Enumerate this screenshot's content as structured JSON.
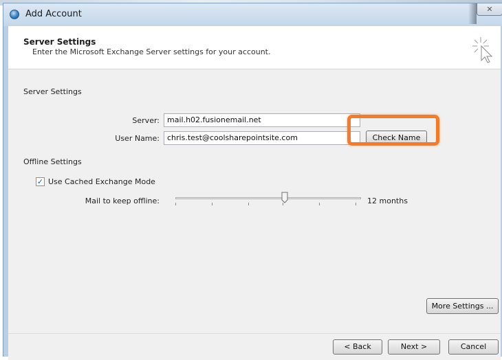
{
  "window": {
    "title": "Add Account",
    "close_glyph": "✕"
  },
  "header": {
    "title": "Server Settings",
    "subtitle": "Enter the Microsoft Exchange Server settings for your account."
  },
  "server_settings": {
    "heading": "Server Settings",
    "server_label": "Server:",
    "server_value": "mail.h02.fusionemail.net",
    "username_label": "User Name:",
    "username_value": "chris.test@coolsharepointsite.com",
    "check_name_label": "Check Name"
  },
  "offline_settings": {
    "heading": "Offline Settings",
    "cached_mode_label": "Use Cached Exchange Mode",
    "cached_mode_checked": true,
    "mail_keep_label": "Mail to keep offline:",
    "mail_keep_value": "12 months",
    "slider_level_fraction": 0.59
  },
  "buttons": {
    "more_settings": "More Settings ...",
    "back": "< Back",
    "next": "Next >",
    "cancel": "Cancel"
  },
  "colors": {
    "highlight": "#f47b2a",
    "titlebar": "#c4d7ea"
  },
  "icons": {
    "app": "outlook-account-icon",
    "wizard": "cursor-sparkle-icon"
  }
}
